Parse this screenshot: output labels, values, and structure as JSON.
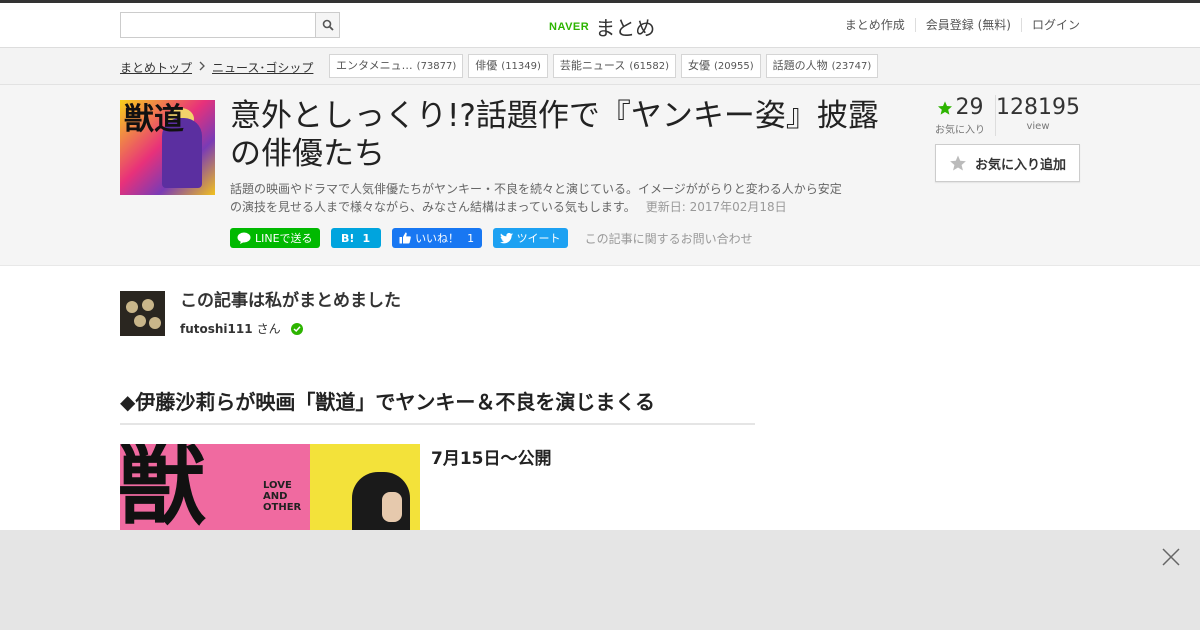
{
  "header": {
    "search": {
      "value": "",
      "placeholder": ""
    },
    "logo": {
      "naver": "NAVER",
      "name": "まとめ"
    },
    "nav": [
      "まとめ作成",
      "会員登録 (無料)",
      "ログイン"
    ]
  },
  "breadcrumb": {
    "home": "まとめトップ",
    "category": "ニュース･ゴシップ"
  },
  "tags": [
    {
      "label": "エンタメニュ…",
      "count": "(73877)"
    },
    {
      "label": "俳優",
      "count": "(11349)"
    },
    {
      "label": "芸能ニュース",
      "count": "(61582)"
    },
    {
      "label": "女優",
      "count": "(20955)"
    },
    {
      "label": "話題の人物",
      "count": "(23747)"
    }
  ],
  "article": {
    "title": "意外としっくり!?話題作で『ヤンキー姿』披露の俳優たち",
    "description": "話題の映画やドラマで人気俳優たちがヤンキー・不良を続々と演じている。イメージががらりと変わる人から安定の演技を見せる人まで様々ながら、みなさん結構はまっている気もします。",
    "updated": "更新日: 2017年02月18日"
  },
  "share": {
    "line": "LINEで送る",
    "hatena_label": "B!",
    "hatena_count": "1",
    "fb_label": "いいね！",
    "fb_count": "1",
    "tweet": "ツイート",
    "contact": "この記事に関するお問い合わせ"
  },
  "stats": {
    "fav_count": "29",
    "fav_label": "お気に入り",
    "views": "128195",
    "views_label": "view"
  },
  "fav_button": "お気に入り追加",
  "author": {
    "heading": "この記事は私がまとめました",
    "name": "futoshi111",
    "suffix": "さん"
  },
  "section": {
    "heading": "◆伊藤沙莉らが映画「獣道」でヤンキー＆不良を演じまくる",
    "release": "7月15日～公開"
  },
  "poster": {
    "big_char": "獣",
    "love_line1": "LOVE",
    "love_line2": "AND",
    "love_line3": "OTHER"
  },
  "thumb": {
    "text": "獣道"
  },
  "colors": {
    "accent": "#2db400",
    "line": "#00b900",
    "hatena": "#00a4de",
    "facebook": "#1877f2",
    "twitter": "#1da1f2"
  }
}
